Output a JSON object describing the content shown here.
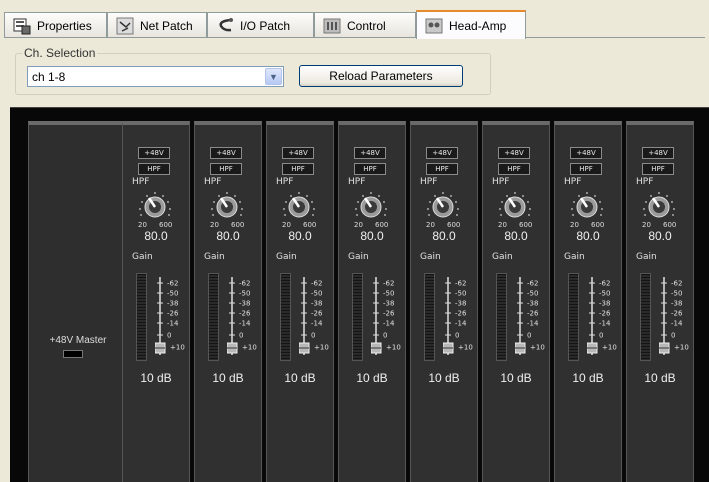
{
  "tabs": [
    {
      "label": "Properties",
      "icon": "properties-icon",
      "active": false
    },
    {
      "label": "Net Patch",
      "icon": "net-patch-icon",
      "active": false
    },
    {
      "label": "I/O Patch",
      "icon": "io-patch-icon",
      "active": false
    },
    {
      "label": "Control",
      "icon": "control-icon",
      "active": false
    },
    {
      "label": "Head-Amp",
      "icon": "head-amp-icon",
      "active": true
    }
  ],
  "ch_selection": {
    "legend": "Ch. Selection",
    "value": "ch 1-8",
    "reload_label": "Reload Parameters"
  },
  "master": {
    "label": "+48V Master"
  },
  "strip_labels": {
    "phantom": "+48V",
    "hpf_button": "HPF",
    "hpf_label": "HPF",
    "knob_min": "20",
    "knob_max": "600",
    "gain_label": "Gain"
  },
  "fader_scale": [
    "-62",
    "-50",
    "-38",
    "-26",
    "-14",
    "0",
    "+10"
  ],
  "channels": [
    {
      "hpf_value": "80.0",
      "gain_value": "10 dB"
    },
    {
      "hpf_value": "80.0",
      "gain_value": "10 dB"
    },
    {
      "hpf_value": "80.0",
      "gain_value": "10 dB"
    },
    {
      "hpf_value": "80.0",
      "gain_value": "10 dB"
    },
    {
      "hpf_value": "80.0",
      "gain_value": "10 dB"
    },
    {
      "hpf_value": "80.0",
      "gain_value": "10 dB"
    },
    {
      "hpf_value": "80.0",
      "gain_value": "10 dB"
    },
    {
      "hpf_value": "80.0",
      "gain_value": "10 dB"
    }
  ]
}
